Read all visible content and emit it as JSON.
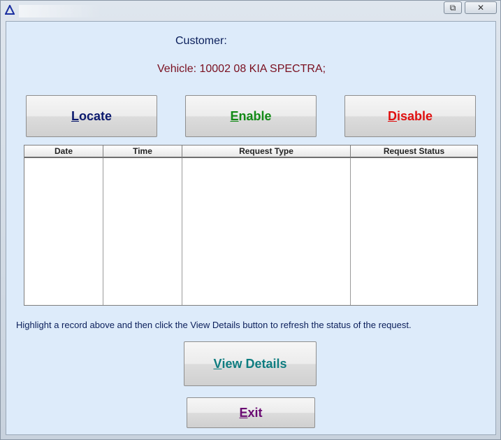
{
  "window": {
    "title": "",
    "restore_glyph": "⧉",
    "close_glyph": "✕",
    "app_icon": "triangle-app-icon",
    "accent": "#0c1a6e"
  },
  "labels": {
    "customer": "Customer:",
    "vehicle": "Vehicle: 10002 08 KIA SPECTRA;"
  },
  "buttons": {
    "locate": {
      "mnemonic": "L",
      "rest": "ocate",
      "color": "#0c1a6e"
    },
    "enable": {
      "mnemonic": "E",
      "rest": "nable",
      "color": "#128a16"
    },
    "disable": {
      "mnemonic": "D",
      "rest": "isable",
      "color": "#e01010"
    },
    "view_details": {
      "mnemonic": "V",
      "rest": "iew Details",
      "color": "#0f7d80"
    },
    "exit": {
      "mnemonic": "E",
      "rest": "xit",
      "color": "#6a0a72"
    }
  },
  "table": {
    "columns": [
      "Date",
      "Time",
      "Request Type",
      "Request Status"
    ],
    "rows": []
  },
  "hint": "Highlight a record above and then click the View Details button to refresh the status of the request."
}
